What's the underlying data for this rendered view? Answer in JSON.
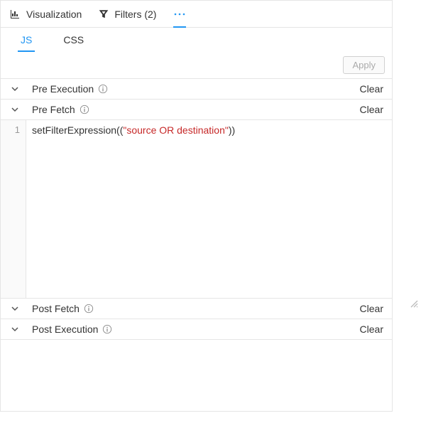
{
  "mainTabs": {
    "visualization": "Visualization",
    "filters": "Filters (2)"
  },
  "subTabs": {
    "js": "JS",
    "css": "CSS"
  },
  "apply": "Apply",
  "sections": {
    "preExecution": {
      "title": "Pre Execution",
      "clear": "Clear"
    },
    "preFetch": {
      "title": "Pre Fetch",
      "clear": "Clear"
    },
    "postFetch": {
      "title": "Post Fetch",
      "clear": "Clear"
    },
    "postExecution": {
      "title": "Post Execution",
      "clear": "Clear"
    }
  },
  "code": {
    "line1_number": "1",
    "line1_fn_open": "setFilterExpression((",
    "line1_string": "\"source OR destination\"",
    "line1_fn_close": "))"
  }
}
